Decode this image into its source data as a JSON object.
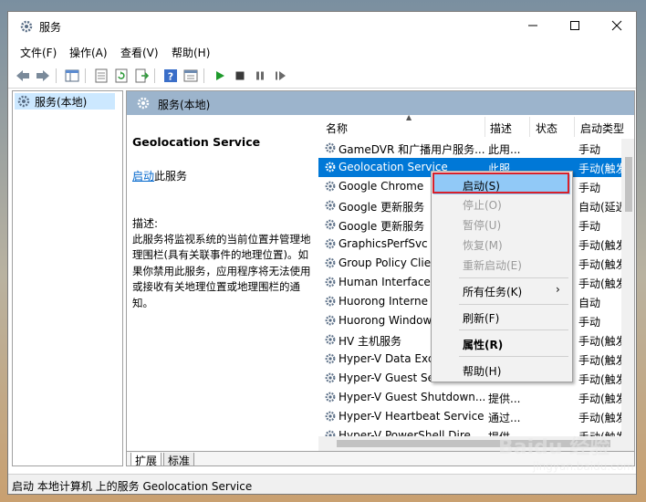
{
  "window": {
    "title": "服务",
    "icon": "gear-icon"
  },
  "menubar": {
    "file": "文件(F)",
    "action": "操作(A)",
    "view": "查看(V)",
    "help": "帮助(H)"
  },
  "tree": {
    "root_label": "服务(本地)"
  },
  "pane": {
    "header_title": "服务(本地)",
    "service_name": "Geolocation Service",
    "start_link": "启动",
    "start_suffix": "此服务",
    "description_label": "描述:",
    "description": "此服务将监视系统的当前位置并管理地理围栏(具有关联事件的地理位置)。如果你禁用此服务，应用程序将无法使用或接收有关地理位置或地理围栏的通知。"
  },
  "list": {
    "columns": [
      "名称",
      "描述",
      "状态",
      "启动类型"
    ],
    "rows": [
      {
        "name": "GameDVR 和广播用户服务...",
        "desc": "此用...",
        "status": "",
        "startup": "手动"
      },
      {
        "name": "Geolocation Service",
        "desc": "此服...",
        "status": "",
        "startup": "手动(触发"
      },
      {
        "name": "Google Chrome",
        "desc": "",
        "status": "",
        "startup": "手动"
      },
      {
        "name": "Google 更新服务",
        "desc": "",
        "status": "",
        "startup": "自动(延迟"
      },
      {
        "name": "Google 更新服务",
        "desc": "",
        "status": "",
        "startup": "手动"
      },
      {
        "name": "GraphicsPerfSvc",
        "desc": "",
        "status": "",
        "startup": "手动(触发"
      },
      {
        "name": "Group Policy Clie",
        "desc": "",
        "status": "",
        "startup": "手动(触发"
      },
      {
        "name": "Human Interface",
        "desc": "",
        "status": "",
        "startup": "手动(触发"
      },
      {
        "name": "Huorong Interne",
        "desc": "",
        "status": "",
        "startup": "自动"
      },
      {
        "name": "Huorong Window",
        "desc": "",
        "status": "",
        "startup": "手动"
      },
      {
        "name": "HV 主机服务",
        "desc": "",
        "status": "",
        "startup": "手动(触发"
      },
      {
        "name": "Hyper-V Data Exc",
        "desc": "",
        "status": "",
        "startup": "手动(触发"
      },
      {
        "name": "Hyper-V Guest Se",
        "desc": "",
        "status": "",
        "startup": "手动(触发"
      },
      {
        "name": "Hyper-V Guest Shutdown...",
        "desc": "提供...",
        "status": "",
        "startup": "手动(触发"
      },
      {
        "name": "Hyper-V Heartbeat Service",
        "desc": "通过...",
        "status": "",
        "startup": "手动(触发"
      },
      {
        "name": "Hyper-V PowerShell Dire...",
        "desc": "提供...",
        "status": "",
        "startup": "手动(触发"
      }
    ]
  },
  "tabs": {
    "extended": "扩展",
    "standard": "标准"
  },
  "context_menu": {
    "start": "启动(S)",
    "stop": "停止(O)",
    "pause": "暂停(U)",
    "resume": "恢复(M)",
    "restart": "重新启动(E)",
    "all_tasks": "所有任务(K)",
    "refresh": "刷新(F)",
    "properties": "属性(R)",
    "help": "帮助(H)"
  },
  "status": {
    "text": "启动 本地计算机 上的服务 Geolocation Service"
  },
  "watermark": {
    "text": "Baidu 经验",
    "sub": "jingyan.baidu.com"
  },
  "colors": {
    "selection": "#0078d7",
    "header_band": "#9cb4cc",
    "highlight_box": "#d8202a",
    "menu_hover": "#91c9f7"
  }
}
